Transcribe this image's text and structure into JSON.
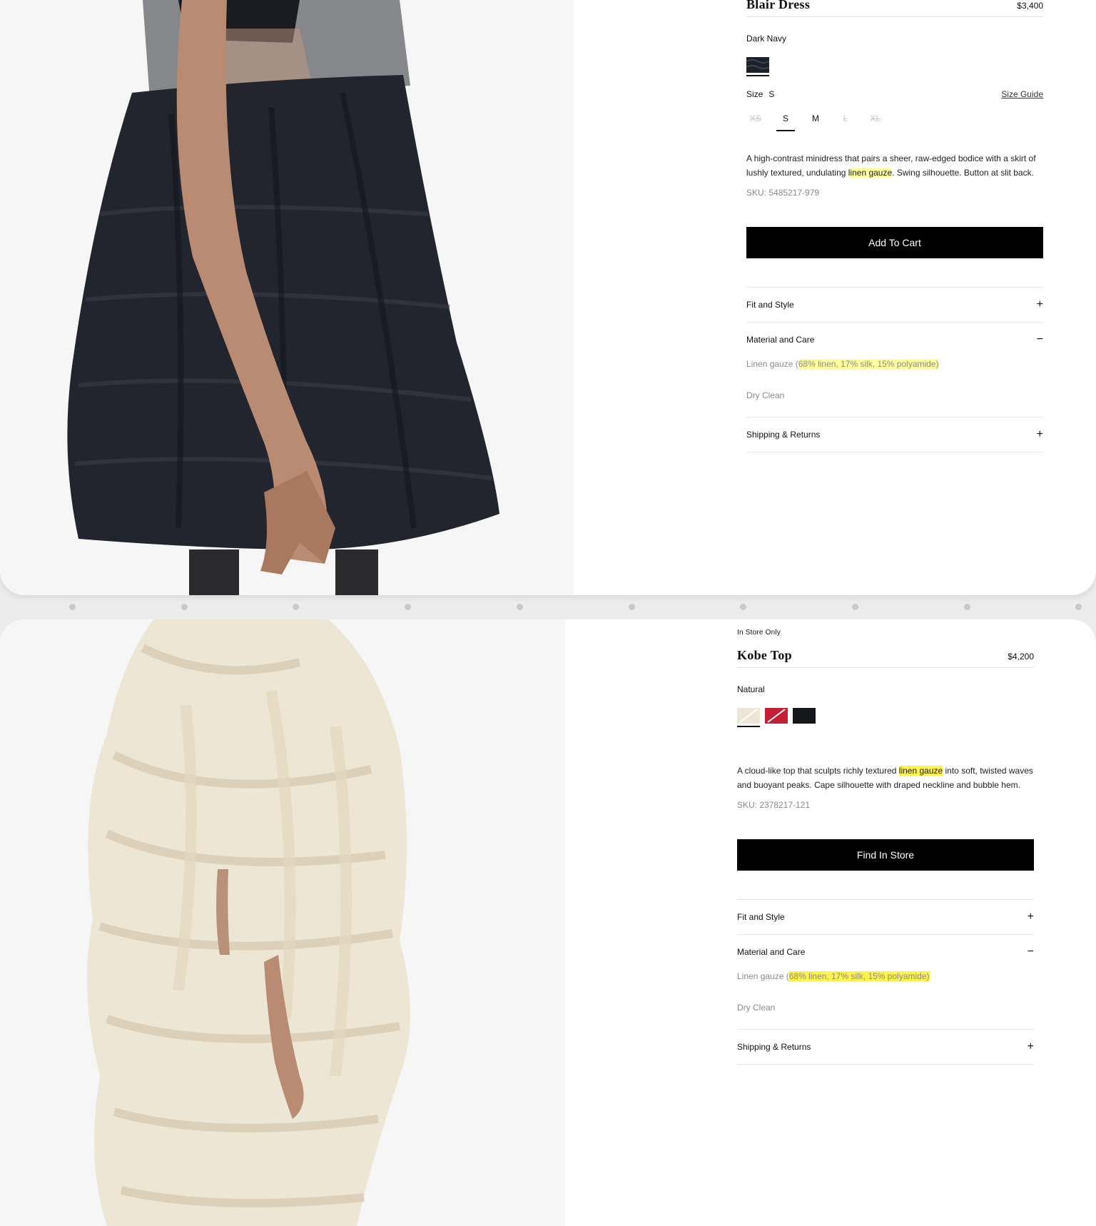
{
  "products": [
    {
      "badge": "",
      "title": "Blair Dress",
      "price": "$3,400",
      "color_name": "Dark Navy",
      "swatches": [
        {
          "name": "Dark Navy",
          "color": "#1c2029",
          "selected": true
        }
      ],
      "size_label": "Size",
      "size_selected": "S",
      "size_guide": "Size Guide",
      "sizes": [
        {
          "label": "XS",
          "available": false
        },
        {
          "label": "S",
          "available": true,
          "selected": true
        },
        {
          "label": "M",
          "available": true
        },
        {
          "label": "L",
          "available": false
        },
        {
          "label": "XL",
          "available": false
        }
      ],
      "description": {
        "before": "A high-contrast minidress that pairs a sheer, raw-edged bodice with a skirt of lushly textured, undulating ",
        "highlight": "linen gauze",
        "after": ". Swing silhouette. Button at slit back."
      },
      "sku": "SKU: 5485217-979",
      "cta": "Add To Cart",
      "accordion": {
        "fit": "Fit and Style",
        "material": "Material and Care",
        "material_text": "Linen gauze (",
        "material_highlight": "68% linen, 17% silk, 15% polyamide)",
        "care": "Dry Clean",
        "shipping": "Shipping & Returns",
        "plus": "+",
        "minus": "−"
      }
    },
    {
      "badge": "In Store Only",
      "title": "Kobe Top",
      "price": "$4,200",
      "color_name": "Natural",
      "swatches": [
        {
          "name": "Natural",
          "color": "#efe5d4",
          "selected": true
        },
        {
          "name": "Red",
          "color": "#c51f36",
          "selected": false
        },
        {
          "name": "Black",
          "color": "#16171b",
          "selected": false
        }
      ],
      "description": {
        "before": "A cloud-like top that sculpts richly textured ",
        "highlight": "linen gauze",
        "after": " into soft, twisted waves and buoyant peaks. Cape silhouette with draped neckline and bubble hem."
      },
      "sku": "SKU: 2378217-121",
      "cta": "Find In Store",
      "accordion": {
        "fit": "Fit and Style",
        "material": "Material and Care",
        "material_text": "Linen gauze (",
        "material_highlight": "68% linen, 17% silk, 15% polyamide)",
        "care": "Dry Clean",
        "shipping": "Shipping & Returns",
        "plus": "+",
        "minus": "−"
      }
    }
  ],
  "colors": {
    "highlight_soft": "#ffff9e",
    "highlight_strong": "#fff24d",
    "button": "#000000"
  }
}
